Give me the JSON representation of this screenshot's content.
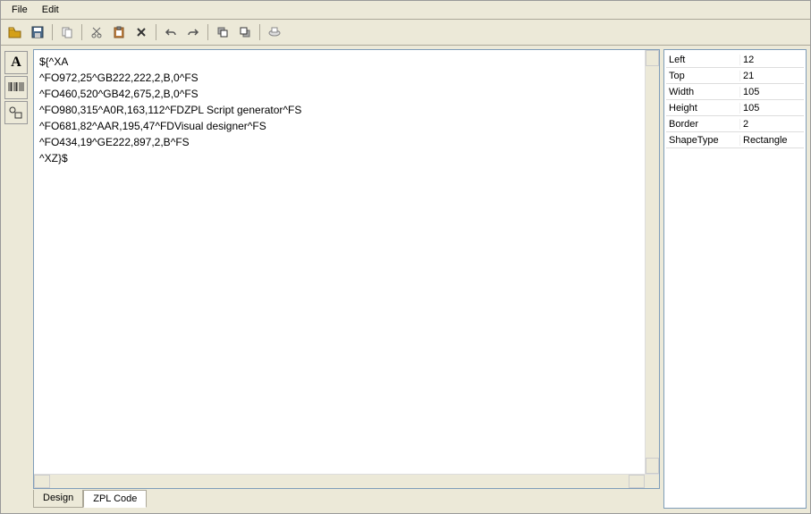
{
  "menu": {
    "file": "File",
    "edit": "Edit"
  },
  "tools": {
    "text_label": "A"
  },
  "editor": {
    "content": "${^XA\n^FO972,25^GB222,222,2,B,0^FS\n^FO460,520^GB42,675,2,B,0^FS\n^FO980,315^A0R,163,112^FDZPL Script generator^FS\n^FO681,82^AAR,195,47^FDVisual designer^FS\n^FO434,19^GE222,897,2,B^FS\n^XZ}$"
  },
  "tabs": {
    "design": "Design",
    "zpl": "ZPL Code"
  },
  "properties": [
    {
      "label": "Left",
      "value": "12"
    },
    {
      "label": "Top",
      "value": "21"
    },
    {
      "label": "Width",
      "value": "105"
    },
    {
      "label": "Height",
      "value": "105"
    },
    {
      "label": "Border",
      "value": "2"
    },
    {
      "label": "ShapeType",
      "value": "Rectangle"
    }
  ]
}
